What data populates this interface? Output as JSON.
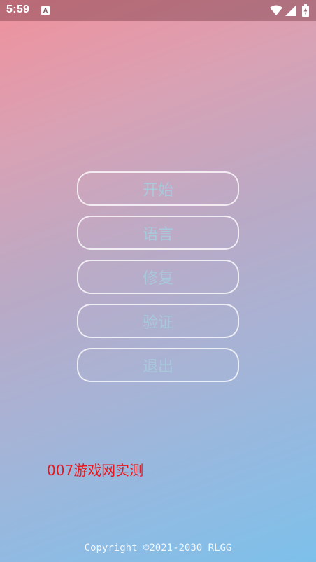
{
  "status_bar": {
    "time": "5:59",
    "notification_icon": "text-a-icon",
    "notification_letter": "A",
    "wifi_icon": "wifi-icon",
    "signal_icon": "signal-icon",
    "battery_icon": "battery-charging-icon"
  },
  "menu": {
    "items": [
      {
        "label": "开始"
      },
      {
        "label": "语言"
      },
      {
        "label": "修复"
      },
      {
        "label": "验证"
      },
      {
        "label": "退出"
      }
    ]
  },
  "watermark": "007游戏网实测",
  "footer": {
    "copyright": "Copyright ©2021-2030 RLGG"
  },
  "colors": {
    "gradient_top": "#f0919c",
    "gradient_bottom": "#7cc0ea",
    "button_text": "#a8c8dc",
    "button_border": "#ffffff",
    "watermark": "#e8161c"
  }
}
